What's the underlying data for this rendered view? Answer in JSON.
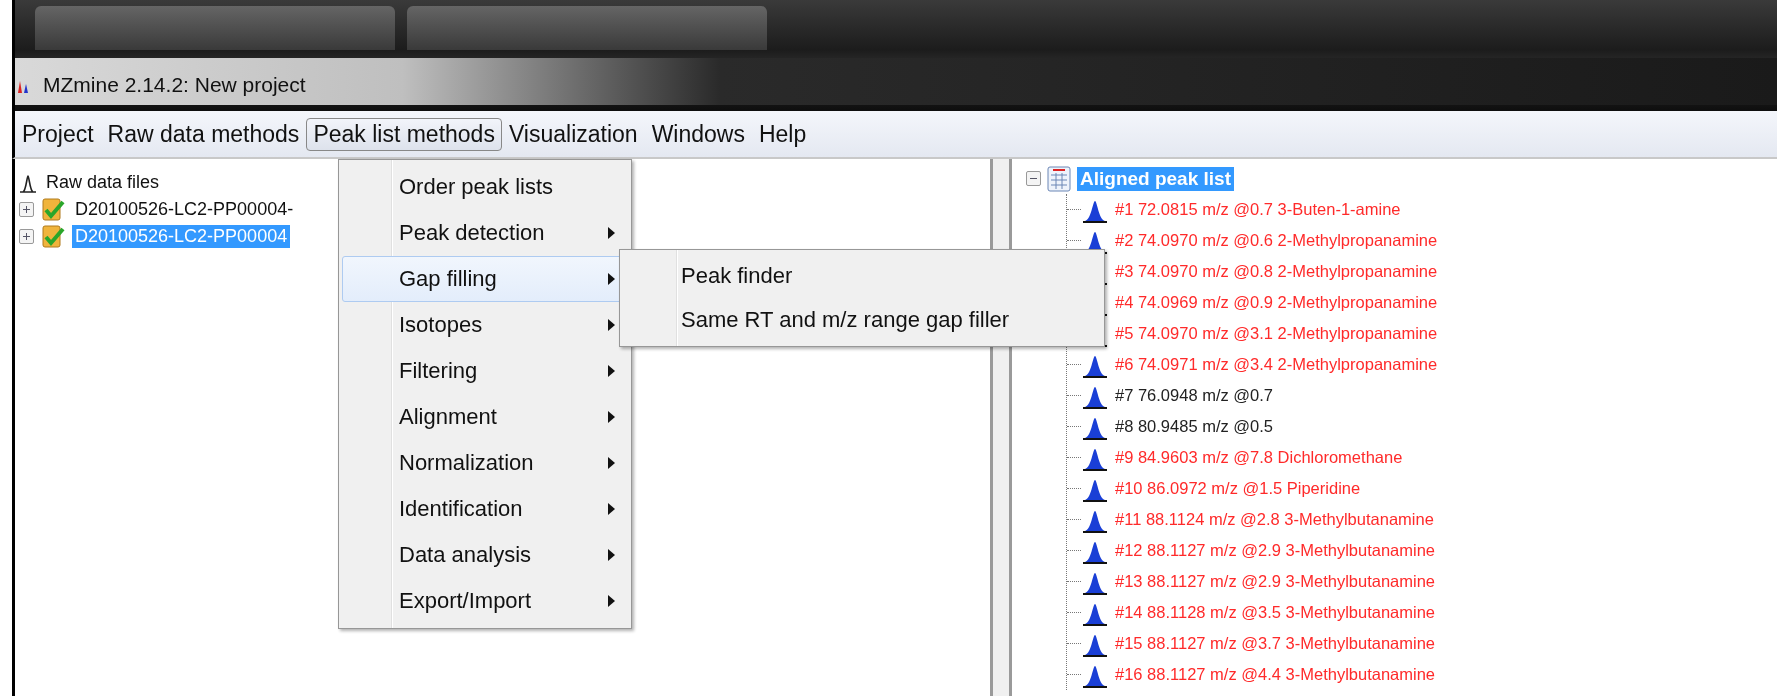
{
  "window": {
    "title": "MZmine 2.14.2: New project"
  },
  "menubar": [
    {
      "label": "Project",
      "selected": false
    },
    {
      "label": "Raw data methods",
      "selected": false
    },
    {
      "label": "Peak list methods",
      "selected": true
    },
    {
      "label": "Visualization",
      "selected": false
    },
    {
      "label": "Windows",
      "selected": false
    },
    {
      "label": "Help",
      "selected": false
    }
  ],
  "menu": {
    "items": [
      {
        "label": "Order peak lists",
        "submenu": false,
        "selected": false
      },
      {
        "label": "Peak detection",
        "submenu": true,
        "selected": false
      },
      {
        "label": "Gap filling",
        "submenu": true,
        "selected": true
      },
      {
        "label": "Isotopes",
        "submenu": true,
        "selected": false
      },
      {
        "label": "Filtering",
        "submenu": true,
        "selected": false
      },
      {
        "label": "Alignment",
        "submenu": true,
        "selected": false
      },
      {
        "label": "Normalization",
        "submenu": true,
        "selected": false
      },
      {
        "label": "Identification",
        "submenu": true,
        "selected": false
      },
      {
        "label": "Data analysis",
        "submenu": true,
        "selected": false
      },
      {
        "label": "Export/Import",
        "submenu": true,
        "selected": false
      }
    ],
    "submenu": [
      {
        "label": "Peak finder"
      },
      {
        "label": "Same RT and m/z range gap filler"
      }
    ]
  },
  "raw_data_tree": {
    "label": "Raw data files",
    "children": [
      {
        "label": "D20100526-LC2-PP00004-",
        "expanded": false,
        "selected": false
      },
      {
        "label": "D20100526-LC2-PP00004",
        "expanded": false,
        "selected": true
      }
    ]
  },
  "peak_list_tree": {
    "label": "Aligned peak list",
    "expanded": true,
    "selected": true,
    "children": [
      {
        "label": "#1 72.0815 m/z @0.7 3-Buten-1-amine",
        "color": "#ff2a2a"
      },
      {
        "label": "#2 74.0970 m/z @0.6 2-Methylpropanamine",
        "color": "#ff2a2a"
      },
      {
        "label": "#3 74.0970 m/z @0.8 2-Methylpropanamine",
        "color": "#ff2a2a"
      },
      {
        "label": "#4 74.0969 m/z @0.9 2-Methylpropanamine",
        "color": "#ff2a2a"
      },
      {
        "label": "#5 74.0970 m/z @3.1 2-Methylpropanamine",
        "color": "#ff2a2a"
      },
      {
        "label": "#6 74.0971 m/z @3.4 2-Methylpropanamine",
        "color": "#ff2a2a"
      },
      {
        "label": "#7 76.0948 m/z @0.7",
        "color": "#222222"
      },
      {
        "label": "#8 80.9485 m/z @0.5",
        "color": "#222222"
      },
      {
        "label": "#9 84.9603 m/z @7.8 Dichloromethane",
        "color": "#ff2a2a"
      },
      {
        "label": "#10 86.0972 m/z @1.5 Piperidine",
        "color": "#ff2a2a"
      },
      {
        "label": "#11 88.1124 m/z @2.8 3-Methylbutanamine",
        "color": "#ff2a2a"
      },
      {
        "label": "#12 88.1127 m/z @2.9 3-Methylbutanamine",
        "color": "#ff2a2a"
      },
      {
        "label": "#13 88.1127 m/z @2.9 3-Methylbutanamine",
        "color": "#ff2a2a"
      },
      {
        "label": "#14 88.1128 m/z @3.5 3-Methylbutanamine",
        "color": "#ff2a2a"
      },
      {
        "label": "#15 88.1127 m/z @3.7 3-Methylbutanamine",
        "color": "#ff2a2a"
      },
      {
        "label": "#16 88.1127 m/z @4.4 3-Methylbutanamine",
        "color": "#ff2a2a"
      }
    ]
  }
}
